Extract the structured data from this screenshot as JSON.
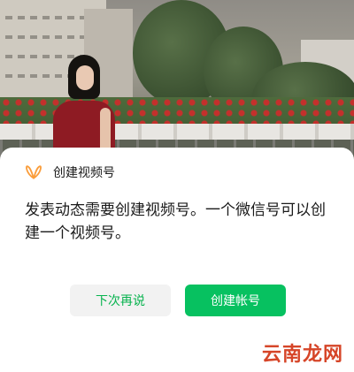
{
  "dialog": {
    "title": "创建视频号",
    "message": "发表动态需要创建视频号。一个微信号可以创建一个视频号。",
    "secondary_button": "下次再说",
    "primary_button": "创建帐号",
    "accent_color": "#07c160",
    "logo_icon": "channels-butterfly-icon",
    "logo_color": "#fa9d3b"
  },
  "watermark": {
    "text": "云南龙网",
    "color": "#d64528"
  }
}
